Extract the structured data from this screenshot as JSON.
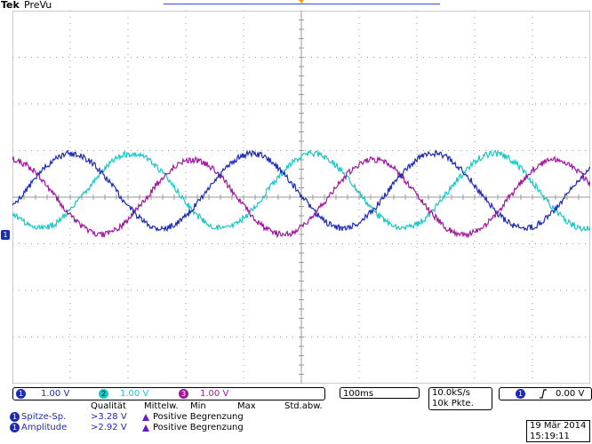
{
  "header": {
    "brand": "Tek",
    "acq_state": "PreVu"
  },
  "colors": {
    "ch1": "#1d2ab3",
    "ch2": "#18c8c8",
    "ch3": "#a0179c",
    "grid": "#9a9a9a",
    "trigger_marker": "#ff9f00",
    "record_bar": "#3a44ff"
  },
  "channels": [
    {
      "badge": "1",
      "scale": "1.00 V"
    },
    {
      "badge": "2",
      "scale": "1.00 V"
    },
    {
      "badge": "3",
      "scale": "1.00 V"
    }
  ],
  "ground_marker": "1",
  "timebase": "100ms",
  "acquisition": {
    "sample_rate": "10.0kS/s",
    "record_length": "10k Pkte."
  },
  "trigger": {
    "source": "1",
    "slope_icon": "rising-edge-icon",
    "level": "0.00 V"
  },
  "measurements": {
    "headers": {
      "quality": "Qualität",
      "mean": "Mittelw.",
      "min": "Min",
      "max": "Max",
      "std": "Std.abw."
    },
    "rows": [
      {
        "source": "1",
        "name": "Spitze-Sp.",
        "value": ">3.28 V",
        "quality": "Positive Begrenzung"
      },
      {
        "source": "1",
        "name": "Amplitude",
        "value": ">2.92 V",
        "quality": "Positive Begrenzung"
      }
    ]
  },
  "timestamp": {
    "date": "19 Mär 2014",
    "time": "15:19:11"
  }
}
